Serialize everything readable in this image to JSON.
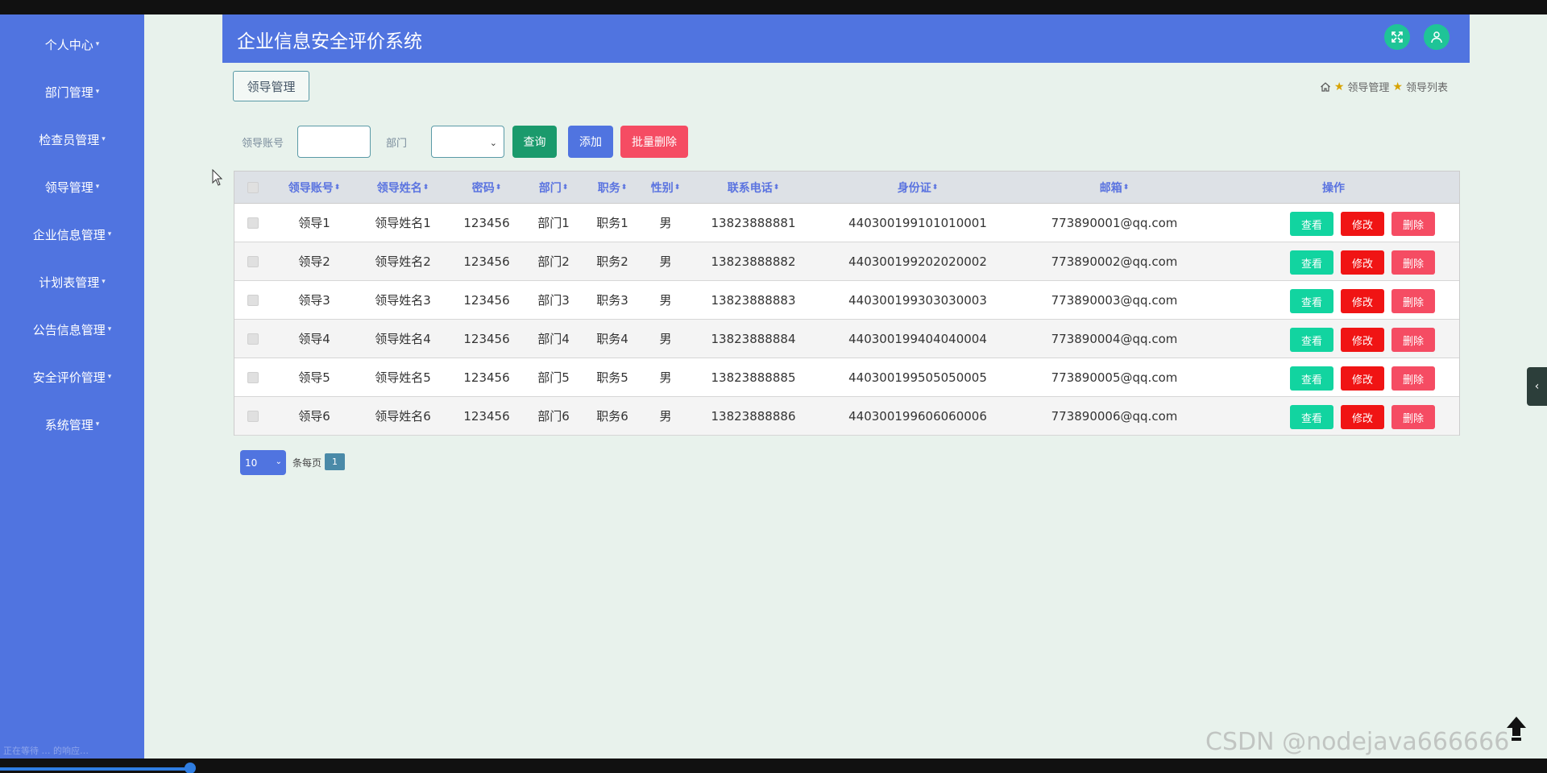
{
  "app": {
    "title": "企业信息安全评价系统"
  },
  "sidebar": {
    "items": [
      {
        "label": "个人中心"
      },
      {
        "label": "部门管理"
      },
      {
        "label": "检查员管理"
      },
      {
        "label": "领导管理"
      },
      {
        "label": "企业信息管理"
      },
      {
        "label": "计划表管理"
      },
      {
        "label": "公告信息管理"
      },
      {
        "label": "安全评价管理"
      },
      {
        "label": "系统管理"
      }
    ],
    "caret": "▾",
    "status_text": "正在等待 … 的响应…"
  },
  "header": {
    "fullscreen_icon": "expand-icon",
    "user_icon": "user-icon",
    "accent": "#1fc497"
  },
  "page": {
    "crumb_box": "领导管理"
  },
  "breadcrumb": {
    "items": [
      "领导管理",
      "领导列表"
    ]
  },
  "search": {
    "account_label": "领导账号",
    "account_value": "",
    "dept_label": "部门",
    "dept_value": "",
    "query_button": "查询",
    "add_button": "添加",
    "batch_delete_button": "批量删除"
  },
  "table": {
    "sort_glyph": "⬍",
    "headers": {
      "account": "领导账号",
      "name": "领导姓名",
      "password": "密码",
      "department": "部门",
      "position": "职务",
      "gender": "性别",
      "phone": "联系电话",
      "id_card": "身份证",
      "email": "邮箱",
      "actions": "操作"
    },
    "rows": [
      {
        "account": "领导1",
        "name": "领导姓名1",
        "password": "123456",
        "department": "部门1",
        "position": "职务1",
        "gender": "男",
        "phone": "13823888881",
        "id_card": "440300199101010001",
        "email": "773890001@qq.com"
      },
      {
        "account": "领导2",
        "name": "领导姓名2",
        "password": "123456",
        "department": "部门2",
        "position": "职务2",
        "gender": "男",
        "phone": "13823888882",
        "id_card": "440300199202020002",
        "email": "773890002@qq.com"
      },
      {
        "account": "领导3",
        "name": "领导姓名3",
        "password": "123456",
        "department": "部门3",
        "position": "职务3",
        "gender": "男",
        "phone": "13823888883",
        "id_card": "440300199303030003",
        "email": "773890003@qq.com"
      },
      {
        "account": "领导4",
        "name": "领导姓名4",
        "password": "123456",
        "department": "部门4",
        "position": "职务4",
        "gender": "男",
        "phone": "13823888884",
        "id_card": "440300199404040004",
        "email": "773890004@qq.com"
      },
      {
        "account": "领导5",
        "name": "领导姓名5",
        "password": "123456",
        "department": "部门5",
        "position": "职务5",
        "gender": "男",
        "phone": "13823888885",
        "id_card": "440300199505050005",
        "email": "773890005@qq.com"
      },
      {
        "account": "领导6",
        "name": "领导姓名6",
        "password": "123456",
        "department": "部门6",
        "position": "职务6",
        "gender": "男",
        "phone": "13823888886",
        "id_card": "440300199606060006",
        "email": "773890006@qq.com"
      }
    ],
    "actions": {
      "view": "查看",
      "edit": "修改",
      "delete": "删除"
    }
  },
  "pagination": {
    "page_size": "10",
    "per_page_label": "条每页",
    "current_page": "1"
  },
  "colors": {
    "sidebar": "#5074e0",
    "query": "#1a9a6c",
    "add": "#5074e0",
    "batch_delete": "#f54c63",
    "view": "#12d4a0",
    "edit": "#f01414",
    "delete": "#f54c63"
  },
  "watermark": "CSDN @nodejava666666"
}
